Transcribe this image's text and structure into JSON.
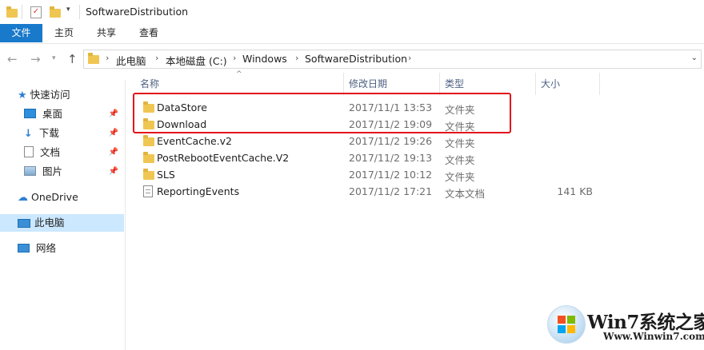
{
  "window": {
    "title": "SoftwareDistribution"
  },
  "ribbon": {
    "tabs": [
      "文件",
      "主页",
      "共享",
      "查看"
    ]
  },
  "address": {
    "crumbs": [
      "此电脑",
      "本地磁盘 (C:)",
      "Windows",
      "SoftwareDistribution"
    ]
  },
  "sidebar": {
    "quick_access": "快速访问",
    "items": [
      {
        "label": "桌面",
        "icon": "desktop-icon",
        "pinned": true
      },
      {
        "label": "下载",
        "icon": "download-icon",
        "pinned": true
      },
      {
        "label": "文档",
        "icon": "document-icon",
        "pinned": true
      },
      {
        "label": "图片",
        "icon": "pictures-icon",
        "pinned": true
      }
    ],
    "onedrive": "OneDrive",
    "this_pc": "此电脑",
    "network": "网络"
  },
  "columns": {
    "name": "名称",
    "date": "修改日期",
    "type": "类型",
    "size": "大小"
  },
  "files": [
    {
      "name": "DataStore",
      "date": "2017/11/1 13:53",
      "type": "文件夹",
      "size": "",
      "kind": "folder"
    },
    {
      "name": "Download",
      "date": "2017/11/2 19:09",
      "type": "文件夹",
      "size": "",
      "kind": "folder"
    },
    {
      "name": "EventCache.v2",
      "date": "2017/11/2 19:26",
      "type": "文件夹",
      "size": "",
      "kind": "folder"
    },
    {
      "name": "PostRebootEventCache.V2",
      "date": "2017/11/2 19:13",
      "type": "文件夹",
      "size": "",
      "kind": "folder"
    },
    {
      "name": "SLS",
      "date": "2017/11/2 10:12",
      "type": "文件夹",
      "size": "",
      "kind": "folder"
    },
    {
      "name": "ReportingEvents",
      "date": "2017/11/2 17:21",
      "type": "文本文档",
      "size": "141 KB",
      "kind": "text"
    }
  ],
  "highlight_color": "#e3131b",
  "watermark": {
    "brand": "Win7系统之家",
    "url": "Www.Winwin7.com"
  }
}
